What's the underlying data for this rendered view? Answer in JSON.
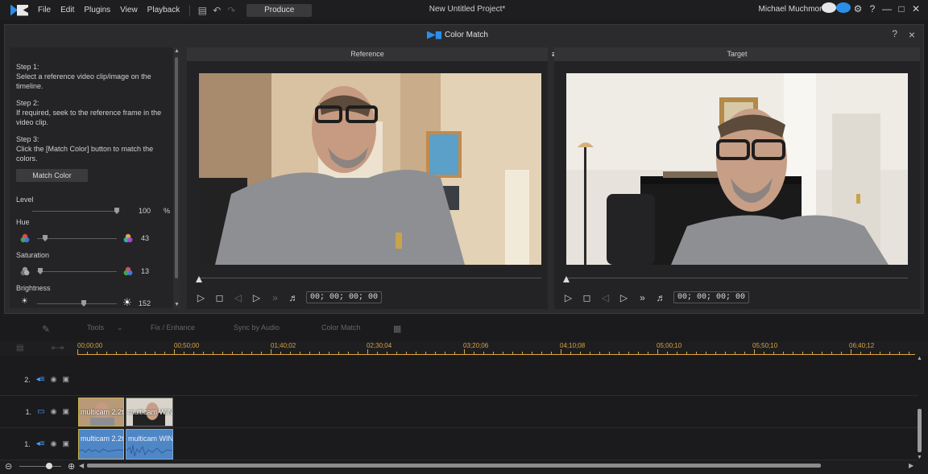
{
  "menubar": {
    "items": [
      "File",
      "Edit",
      "Plugins",
      "View",
      "Playback"
    ],
    "produce_label": "Produce",
    "project_title": "New Untitled Project*",
    "user_name": "Michael Muchmore"
  },
  "dialog": {
    "title": "Color Match",
    "help": "?",
    "close": "×",
    "steps": [
      {
        "title": "Step 1:",
        "text": "Select a reference video clip/image on the timeline."
      },
      {
        "title": "Step 2:",
        "text": "If required, seek to the reference frame in the video clip."
      },
      {
        "title": "Step 3:",
        "text": "Click the [Match Color] button to match the colors."
      }
    ],
    "match_button": "Match Color",
    "level": {
      "label": "Level",
      "value": "100",
      "unit": "%",
      "fraction": 1.0
    },
    "hue": {
      "label": "Hue",
      "value": "43",
      "fraction": 0.1
    },
    "saturation": {
      "label": "Saturation",
      "value": "13",
      "fraction": 0.05
    },
    "brightness": {
      "label": "Brightness",
      "value": "152",
      "fraction": 0.6
    }
  },
  "reference": {
    "header": "Reference",
    "timecode": "00; 00; 00; 00"
  },
  "target": {
    "header": "Target",
    "timecode": "00; 00; 00; 00"
  },
  "toolbar": {
    "tools_label": "Tools",
    "fix_label": "Fix / Enhance",
    "sync_label": "Sync by Audio",
    "colormatch_label": "Color Match"
  },
  "ruler": {
    "ticks": [
      "00;00;00",
      "00;50;00",
      "01;40;02",
      "02;30;04",
      "03;20;06",
      "04;10;08",
      "05;00;10",
      "05;50;10",
      "06;40;12"
    ]
  },
  "tracks": [
    {
      "number": "2.",
      "type": "audio"
    },
    {
      "number": "1.",
      "type": "video"
    },
    {
      "number": "1.",
      "type": "audio"
    }
  ],
  "clips": {
    "video1_label": "multicam 2.2t",
    "video2_label": "multicam WIN",
    "audio1_label": "multicam 2.2t",
    "audio2_label": "multicam WIN"
  },
  "colors": {
    "accent": "#2a8fe8",
    "ruler": "#d9a441",
    "audio_clip": "#4f86c6"
  }
}
